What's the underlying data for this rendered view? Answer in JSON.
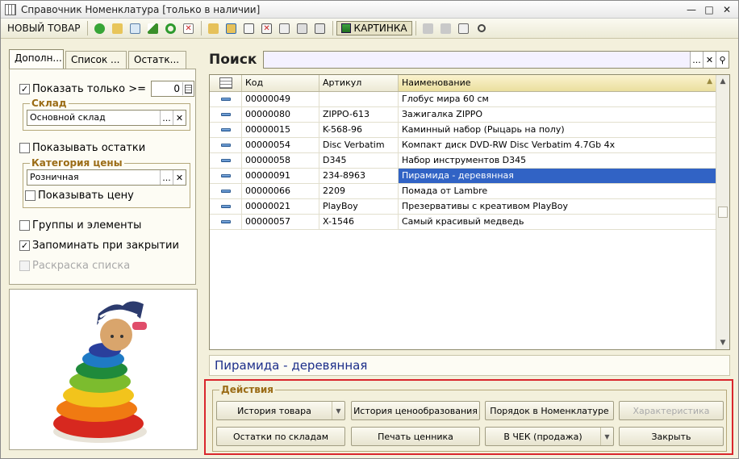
{
  "window": {
    "title": "Справочник Номенклатура [только в наличии]"
  },
  "toolbar": {
    "new_item_label": "НОВЫЙ ТОВАР",
    "picture_label": "КАРТИНКА"
  },
  "left_tabs": [
    {
      "label": "Дополн..."
    },
    {
      "label": "Список ..."
    },
    {
      "label": "Остатк..."
    }
  ],
  "filters": {
    "show_only_label": "Показать только >=",
    "show_only_checked": true,
    "show_only_value": "0",
    "warehouse_group_title": "Склад",
    "warehouse_value": "Основной склад",
    "show_stock_label": "Показывать остатки",
    "show_stock_checked": false,
    "price_category_title": "Категория цены",
    "price_category_value": "Розничная",
    "show_price_label": "Показывать цену",
    "show_price_checked": false,
    "groups_label": "Группы и элементы",
    "groups_checked": false,
    "remember_label": "Запоминать при закрытии",
    "remember_checked": true,
    "coloring_label": "Раскраска списка",
    "coloring_checked": false
  },
  "search": {
    "label": "Поиск",
    "value": ""
  },
  "grid": {
    "columns": [
      "Код",
      "Артикул",
      "Наименование"
    ],
    "rows": [
      {
        "code": "00000049",
        "article": "",
        "name": "Глобус мира 60 см"
      },
      {
        "code": "00000080",
        "article": "ZIPPO-613",
        "name": "Зажигалка ZIPPO"
      },
      {
        "code": "00000015",
        "article": "K-568-96",
        "name": "Каминный набор (Рыцарь на полу)"
      },
      {
        "code": "00000054",
        "article": "Disc Verbatim",
        "name": "Компакт диск DVD-RW Disc Verbatim 4.7Gb 4x"
      },
      {
        "code": "00000058",
        "article": "D345",
        "name": "Набор инструментов D345"
      },
      {
        "code": "00000091",
        "article": "234-8963",
        "name": "Пирамида - деревянная"
      },
      {
        "code": "00000066",
        "article": "2209",
        "name": "Помада от Lambre"
      },
      {
        "code": "00000021",
        "article": "PlayBoy",
        "name": "Презервативы с креативом PlayBoy"
      },
      {
        "code": "00000057",
        "article": "X-1546",
        "name": "Самый красивый медведь"
      }
    ],
    "selected_index": 5
  },
  "selected_name": "Пирамида - деревянная",
  "actions": {
    "title": "Действия",
    "history": "История товара",
    "price_history": "История ценообразования",
    "order": "Порядок в Номенклатуре",
    "characteristic": "Характеристика",
    "stock_by_warehouse": "Остатки по складам",
    "print_tag": "Печать ценника",
    "to_receipt": "В ЧЕК (продажа)",
    "close": "Закрыть"
  }
}
